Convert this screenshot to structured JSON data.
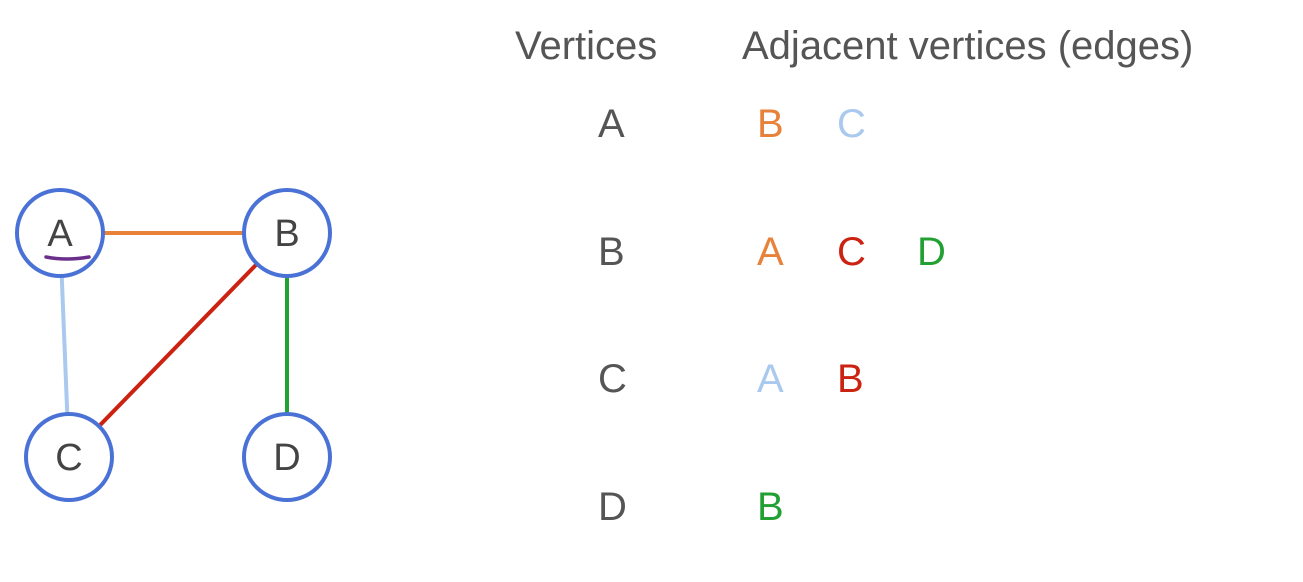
{
  "graph": {
    "nodes": [
      {
        "id": "A",
        "label": "A"
      },
      {
        "id": "B",
        "label": "B"
      },
      {
        "id": "C",
        "label": "C"
      },
      {
        "id": "D",
        "label": "D"
      }
    ],
    "edges": [
      {
        "from": "A",
        "to": "B",
        "color": "#e8823a"
      },
      {
        "from": "A",
        "to": "C",
        "color": "#a9c9ee"
      },
      {
        "from": "B",
        "to": "C",
        "color": "#cc2211"
      },
      {
        "from": "B",
        "to": "D",
        "color": "#22a033"
      }
    ],
    "node_stroke_color": "#4a72d6",
    "highlight_underline_color": "#6a2f8a"
  },
  "table": {
    "header_vertices": "Vertices",
    "header_adjacent": "Adjacent vertices (edges)",
    "rows": [
      {
        "vertex": "A",
        "adjacent": [
          {
            "label": "B",
            "color": "#e8823a"
          },
          {
            "label": "C",
            "color": "#a9c9ee"
          }
        ]
      },
      {
        "vertex": "B",
        "adjacent": [
          {
            "label": "A",
            "color": "#e8823a"
          },
          {
            "label": "C",
            "color": "#cc2211"
          },
          {
            "label": "D",
            "color": "#22a033"
          }
        ]
      },
      {
        "vertex": "C",
        "adjacent": [
          {
            "label": "A",
            "color": "#a9c9ee"
          },
          {
            "label": "B",
            "color": "#cc2211"
          }
        ]
      },
      {
        "vertex": "D",
        "adjacent": [
          {
            "label": "B",
            "color": "#22a033"
          }
        ]
      }
    ]
  }
}
